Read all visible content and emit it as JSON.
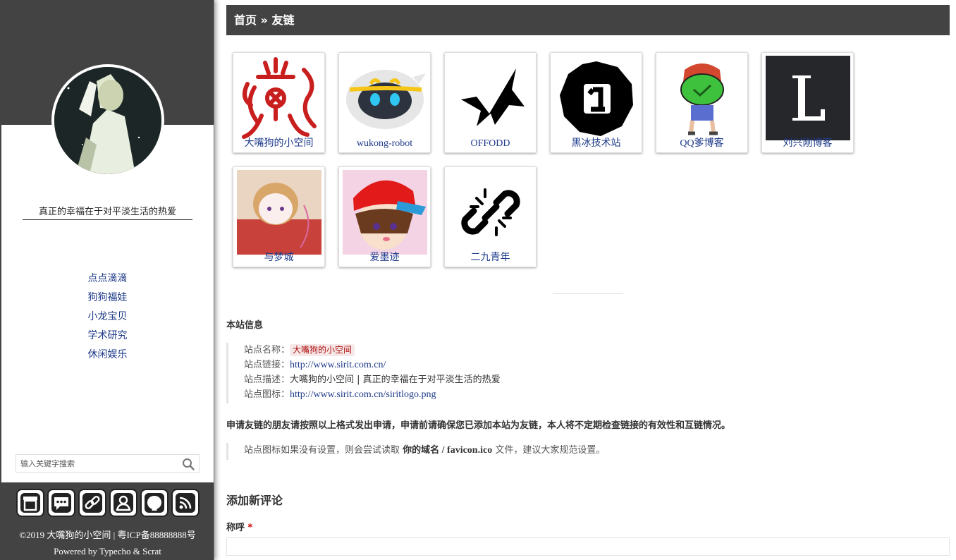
{
  "sidebar": {
    "tagline": "真正的幸福在于对平淡生活的热爱",
    "nav": [
      "点点滴滴",
      "狗狗福娃",
      "小龙宝贝",
      "学术研究",
      "休闲娱乐"
    ],
    "search": {
      "placeholder": "输入关键字搜索",
      "value": ""
    },
    "social_icons": [
      "archive-icon",
      "comments-icon",
      "link-icon",
      "user-icon",
      "github-icon",
      "rss-icon"
    ],
    "copyright": "©2019 大嘴狗的小空间 | 粤ICP备88888888号",
    "powered": "Powered by Typecho & Scrat"
  },
  "breadcrumb": {
    "home": "首页",
    "separator": " » ",
    "current": "友链"
  },
  "links": [
    {
      "name": "大嘴狗的小空间",
      "icon": "red-totem-logo"
    },
    {
      "name": "wukong-robot",
      "icon": "robot-face-logo"
    },
    {
      "name": "OFFODD",
      "icon": "black-x-check-logo"
    },
    {
      "name": "黑冰技术站",
      "icon": "black-octagon-1-logo"
    },
    {
      "name": "QQ爹博客",
      "icon": "frog-hat-character"
    },
    {
      "name": "刘兴刚博客",
      "icon": "letter-l-logo"
    },
    {
      "name": "与梦城",
      "icon": "anime-girl-avatar"
    },
    {
      "name": "爱墨迹",
      "icon": "red-cap-boy-avatar"
    },
    {
      "name": "二九青年",
      "icon": "broken-link-icon"
    }
  ],
  "site_info": {
    "title": "本站信息",
    "name_label": "站点名称：",
    "name_value": "大嘴狗的小空间",
    "url_label": "站点链接：",
    "url_value": "http://www.sirit.com.cn/",
    "desc_label": "站点描述：",
    "desc_value": "大嘴狗的小空间 | 真正的幸福在于对平淡生活的热爱",
    "icon_label": "站点图标：",
    "icon_value": "http://www.sirit.com.cn/siritlogo.png"
  },
  "apply_note": "申请友链的朋友请按照以上格式发出申请，申请前请确保您已添加本站为友链，本人将不定期检查链接的有效性和互链情况。",
  "icon_note": {
    "prefix": "站点图标如果没有设置，则会尝试读取 ",
    "domain": "你的域名",
    "path": " / favicon.ico",
    "suffix": " 文件，建议大家规范设置。"
  },
  "comment": {
    "title": "添加新评论",
    "name_label": "称呼",
    "required_mark": "*",
    "name_value": ""
  },
  "colors": {
    "dark_band": "#434343",
    "link_blue": "#1e3a8a",
    "badge_red": "#b01010"
  }
}
